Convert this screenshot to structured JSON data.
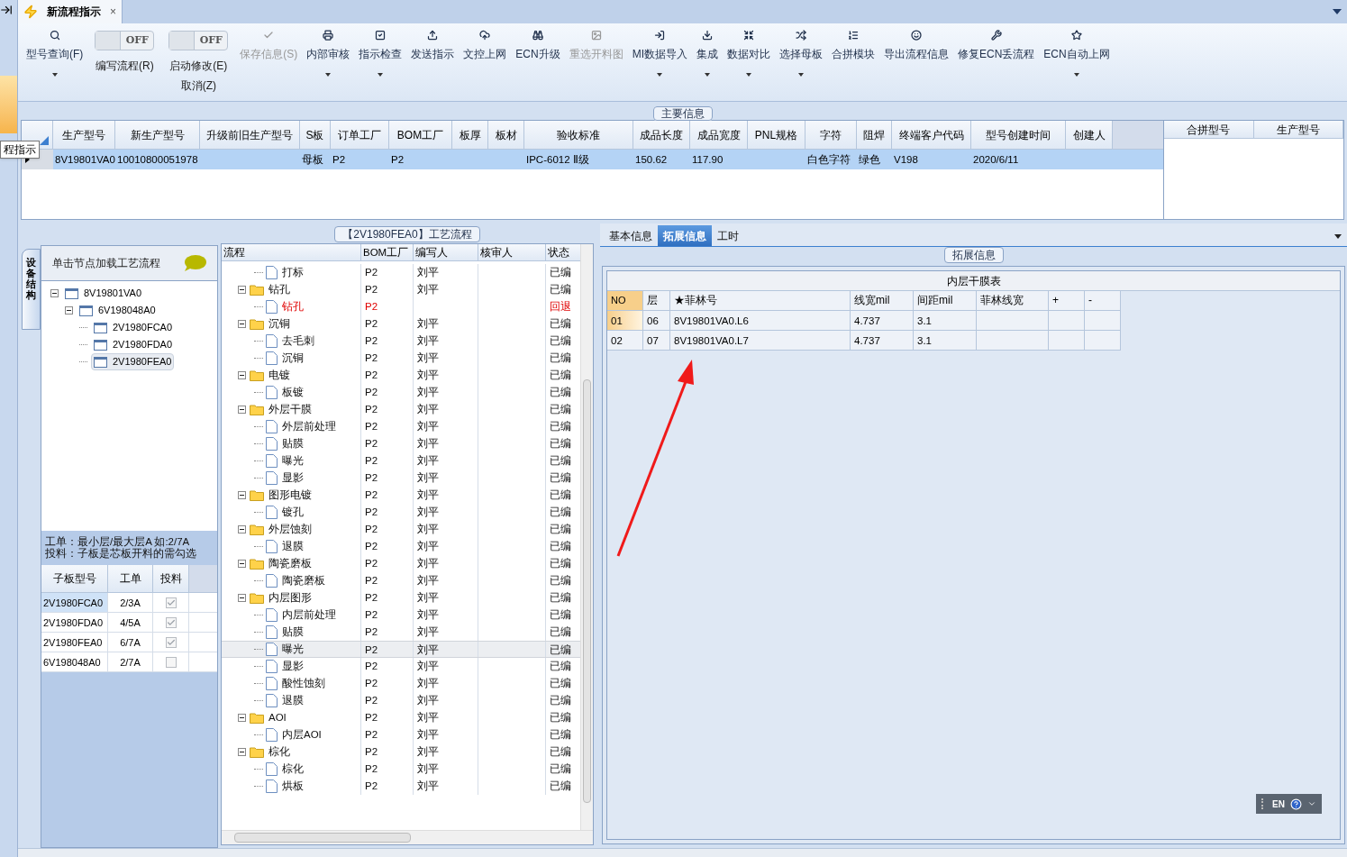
{
  "doc_tabs": [
    {
      "label": "新流程指示",
      "selected": true,
      "close": "×"
    }
  ],
  "tooltip": "程指示",
  "toolbar": [
    {
      "kind": "button",
      "label": "型号查询(F)",
      "caret": true,
      "disabled": false
    },
    {
      "kind": "toggle",
      "label": "编写流程(R)",
      "state": "OFF",
      "on": false
    },
    {
      "kind": "toggle",
      "label": "启动修改(E)",
      "label2": "取消(Z)",
      "state": "OFF",
      "on": false
    },
    {
      "kind": "button",
      "label": "保存信息(S)",
      "caret": false,
      "disabled": true
    },
    {
      "kind": "button",
      "label": "内部审核",
      "caret": true,
      "disabled": false
    },
    {
      "kind": "button",
      "label": "指示检查",
      "caret": true,
      "disabled": false
    },
    {
      "kind": "button",
      "label": "发送指示",
      "caret": false,
      "disabled": false
    },
    {
      "kind": "button",
      "label": "文控上网",
      "caret": false,
      "disabled": false
    },
    {
      "kind": "button",
      "label": "ECN升级",
      "caret": false,
      "disabled": false
    },
    {
      "kind": "button",
      "label": "重选开料图",
      "caret": false,
      "disabled": true
    },
    {
      "kind": "button",
      "label": "MI数据导入",
      "caret": true,
      "disabled": false
    },
    {
      "kind": "button",
      "label": "集成",
      "caret": true,
      "disabled": false
    },
    {
      "kind": "button",
      "label": "数据对比",
      "caret": true,
      "disabled": false
    },
    {
      "kind": "button",
      "label": "选择母板",
      "caret": true,
      "disabled": false
    },
    {
      "kind": "button",
      "label": "合拼模块",
      "caret": false,
      "disabled": false
    },
    {
      "kind": "button",
      "label": "导出流程信息",
      "caret": false,
      "disabled": false
    },
    {
      "kind": "button",
      "label": "修复ECN丢流程",
      "caret": false,
      "disabled": false
    },
    {
      "kind": "button",
      "label": "ECN自动上网",
      "caret": true,
      "disabled": false
    }
  ],
  "main_info": {
    "title": "主要信息",
    "columns": [
      "生产型号",
      "新生产型号",
      "升级前旧生产型号",
      "S板",
      "订单工厂",
      "BOM工厂",
      "板厚",
      "板材",
      "验收标准",
      "成品长度",
      "成品宽度",
      "PNL规格",
      "字符",
      "阻焊",
      "终端客户代码",
      "型号创建时间",
      "创建人"
    ],
    "rows": [
      {
        "selected": true,
        "cells": [
          "8V19801VA0",
          "10010800051978",
          "",
          "母板",
          "P2",
          "P2",
          "",
          "",
          "IPC-6012 Ⅱ级",
          "150.62",
          "117.90",
          "",
          "白色字符",
          "绿色",
          "V198",
          "2020/6/11",
          ""
        ]
      }
    ],
    "merge_columns": [
      "合拼型号",
      "生产型号"
    ]
  },
  "structure": {
    "side_tab": "设备结构",
    "hint": "单击节点加载工艺流程",
    "tree": [
      {
        "label": "8V19801VA0",
        "selected": false,
        "children": [
          {
            "label": "6V198048A0",
            "selected": false,
            "children": [
              {
                "label": "2V1980FCA0",
                "selected": false
              },
              {
                "label": "2V1980FDA0",
                "selected": false
              },
              {
                "label": "2V1980FEA0",
                "selected": true
              }
            ]
          }
        ]
      }
    ],
    "note": [
      "工单：最小层/最大层A 如:2/7A",
      "投料：子板是芯板开料的需勾选"
    ],
    "columns": [
      "子板型号",
      "工单",
      "投料"
    ],
    "rows": [
      {
        "board": "2V1980FCA0",
        "order": "2/3A",
        "checked": true,
        "selected": true
      },
      {
        "board": "2V1980FDA0",
        "order": "4/5A",
        "checked": true,
        "selected": false
      },
      {
        "board": "2V1980FEA0",
        "order": "6/7A",
        "checked": true,
        "selected": false
      },
      {
        "board": "6V198048A0",
        "order": "2/7A",
        "checked": false,
        "selected": false
      }
    ]
  },
  "flow": {
    "title": "【2V1980FEA0】工艺流程",
    "columns": [
      "流程",
      "BOM工厂",
      "编写人",
      "核审人",
      "状态"
    ],
    "rows": [
      {
        "name": "打标",
        "bom": "P2",
        "writer": "刘平",
        "status": "已编",
        "returned": false,
        "selected": false
      },
      {
        "name": "钻孔",
        "bom": "P2",
        "writer": "刘平",
        "status": "已编",
        "returned": false,
        "selected": false,
        "children": [
          {
            "name": "钻孔",
            "bom": "P2",
            "status": "回退",
            "returned": true,
            "selected": false
          }
        ]
      },
      {
        "name": "沉铜",
        "bom": "P2",
        "writer": "刘平",
        "status": "已编",
        "returned": false,
        "selected": false,
        "children": [
          {
            "name": "去毛刺",
            "bom": "P2",
            "writer": "刘平",
            "status": "已编",
            "returned": false,
            "selected": false
          },
          {
            "name": "沉铜",
            "bom": "P2",
            "writer": "刘平",
            "status": "已编",
            "returned": false,
            "selected": false
          }
        ]
      },
      {
        "name": "电镀",
        "bom": "P2",
        "writer": "刘平",
        "status": "已编",
        "returned": false,
        "selected": false,
        "children": [
          {
            "name": "板镀",
            "bom": "P2",
            "writer": "刘平",
            "status": "已编",
            "returned": false,
            "selected": false
          }
        ]
      },
      {
        "name": "外层干膜",
        "bom": "P2",
        "writer": "刘平",
        "status": "已编",
        "returned": false,
        "selected": false,
        "children": [
          {
            "name": "外层前处理",
            "bom": "P2",
            "writer": "刘平",
            "status": "已编",
            "returned": false,
            "selected": false
          },
          {
            "name": "贴膜",
            "bom": "P2",
            "writer": "刘平",
            "status": "已编",
            "returned": false,
            "selected": false
          },
          {
            "name": "曝光",
            "bom": "P2",
            "writer": "刘平",
            "status": "已编",
            "returned": false,
            "selected": false
          },
          {
            "name": "显影",
            "bom": "P2",
            "writer": "刘平",
            "status": "已编",
            "returned": false,
            "selected": false
          }
        ]
      },
      {
        "name": "图形电镀",
        "bom": "P2",
        "writer": "刘平",
        "status": "已编",
        "returned": false,
        "selected": false,
        "children": [
          {
            "name": "镀孔",
            "bom": "P2",
            "writer": "刘平",
            "status": "已编",
            "returned": false,
            "selected": false
          }
        ]
      },
      {
        "name": "外层蚀刻",
        "bom": "P2",
        "writer": "刘平",
        "status": "已编",
        "returned": false,
        "selected": false,
        "children": [
          {
            "name": "退膜",
            "bom": "P2",
            "writer": "刘平",
            "status": "已编",
            "returned": false,
            "selected": false
          }
        ]
      },
      {
        "name": "陶瓷磨板",
        "bom": "P2",
        "writer": "刘平",
        "status": "已编",
        "returned": false,
        "selected": false,
        "children": [
          {
            "name": "陶瓷磨板",
            "bom": "P2",
            "writer": "刘平",
            "status": "已编",
            "returned": false,
            "selected": false
          }
        ]
      },
      {
        "name": "内层图形",
        "bom": "P2",
        "writer": "刘平",
        "status": "已编",
        "returned": false,
        "selected": false,
        "children": [
          {
            "name": "内层前处理",
            "bom": "P2",
            "writer": "刘平",
            "status": "已编",
            "returned": false,
            "selected": false
          },
          {
            "name": "贴膜",
            "bom": "P2",
            "writer": "刘平",
            "status": "已编",
            "returned": false,
            "selected": false
          },
          {
            "name": "曝光",
            "bom": "P2",
            "writer": "刘平",
            "status": "已编",
            "returned": false,
            "selected": true
          },
          {
            "name": "显影",
            "bom": "P2",
            "writer": "刘平",
            "status": "已编",
            "returned": false,
            "selected": false
          },
          {
            "name": "酸性蚀刻",
            "bom": "P2",
            "writer": "刘平",
            "status": "已编",
            "returned": false,
            "selected": false
          },
          {
            "name": "退膜",
            "bom": "P2",
            "writer": "刘平",
            "status": "已编",
            "returned": false,
            "selected": false
          }
        ]
      },
      {
        "name": "AOI",
        "bom": "P2",
        "writer": "刘平",
        "status": "已编",
        "returned": false,
        "selected": false,
        "children": [
          {
            "name": "内层AOI",
            "bom": "P2",
            "writer": "刘平",
            "status": "已编",
            "returned": false,
            "selected": false
          }
        ]
      },
      {
        "name": "棕化",
        "bom": "P2",
        "writer": "刘平",
        "status": "已编",
        "returned": false,
        "selected": false,
        "children": [
          {
            "name": "棕化",
            "bom": "P2",
            "writer": "刘平",
            "status": "已编",
            "returned": false,
            "selected": false
          },
          {
            "name": "烘板",
            "bom": "P2",
            "writer": "刘平",
            "status": "已编",
            "returned": false,
            "selected": false
          }
        ]
      }
    ]
  },
  "detail_tabs": [
    {
      "label": "基本信息",
      "selected": false
    },
    {
      "label": "拓展信息",
      "selected": true
    },
    {
      "label": "工时",
      "selected": false
    }
  ],
  "extended": {
    "title": "拓展信息",
    "table_title": "内层干膜表",
    "columns": [
      "NO",
      "层",
      "★菲林号",
      "线宽mil",
      "间距mil",
      "菲林线宽",
      "+",
      "-"
    ],
    "rows": [
      {
        "selected": true,
        "cells": [
          "01",
          "06",
          "8V19801VA0.L6",
          "4.737",
          "3.1",
          "",
          "",
          ""
        ]
      },
      {
        "selected": false,
        "cells": [
          "02",
          "07",
          "8V19801VA0.L7",
          "4.737",
          "3.1",
          "",
          "",
          ""
        ]
      }
    ]
  },
  "language": "EN"
}
